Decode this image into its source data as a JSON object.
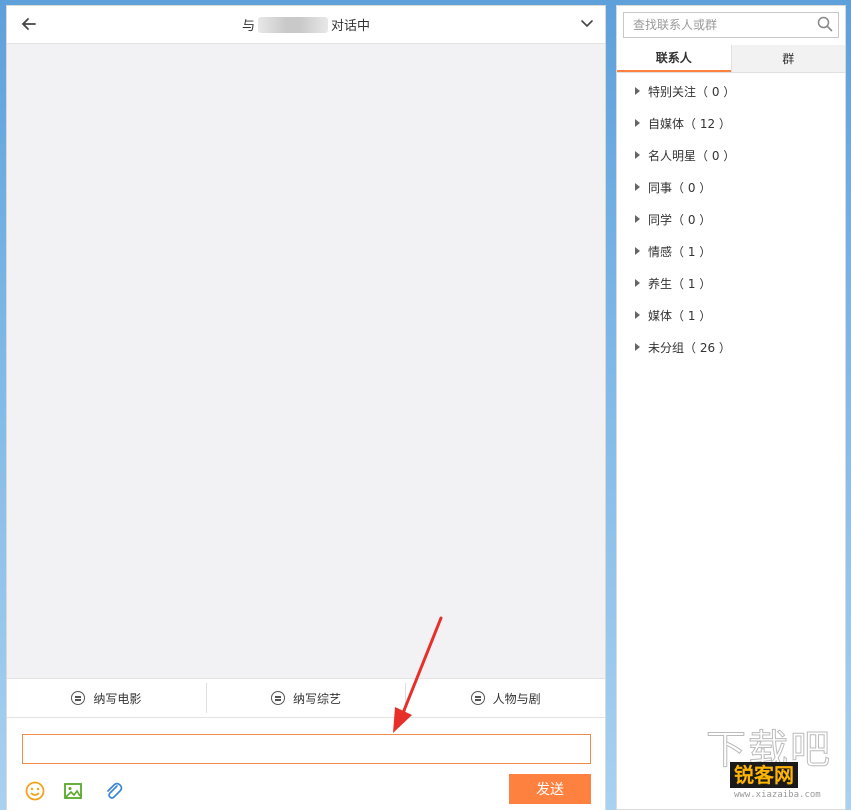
{
  "chat": {
    "title_prefix": "与",
    "title_suffix": "对话中",
    "quick_replies": [
      "纳写电影",
      "纳写综艺",
      "人物与剧"
    ],
    "input_value": "",
    "send_label": "发送"
  },
  "contacts": {
    "search_placeholder": "查找联系人或群",
    "tabs": [
      "联系人",
      "群"
    ],
    "groups": [
      {
        "label": "特别关注（ 0 ）"
      },
      {
        "label": "自媒体（ 12 ）"
      },
      {
        "label": "名人明星（ 0 ）"
      },
      {
        "label": "同事（ 0 ）"
      },
      {
        "label": "同学（ 0 ）"
      },
      {
        "label": "情感（ 1 ）"
      },
      {
        "label": "养生（ 1 ）"
      },
      {
        "label": "媒体（ 1 ）"
      },
      {
        "label": "未分组（ 26 ）"
      }
    ]
  },
  "watermark": {
    "top": "下载吧",
    "brand": "锐客网",
    "url": "www.xiazaiba.com"
  },
  "colors": {
    "accent": "#ff8140",
    "input_border": "#f08b4a",
    "arrow": "#e8302a"
  }
}
